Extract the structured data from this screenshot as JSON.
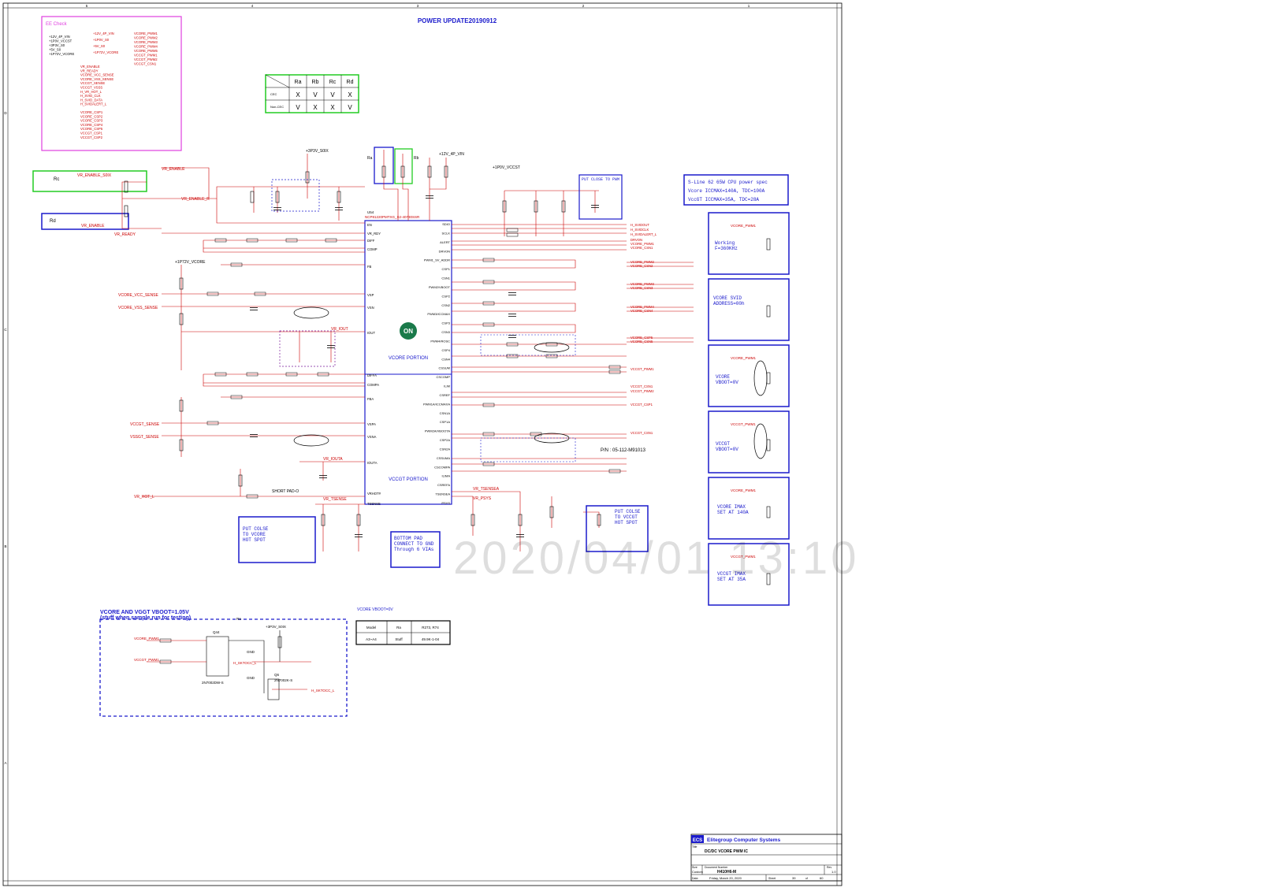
{
  "header": {
    "title": "POWER UPDATE20190912"
  },
  "ee_check": {
    "title": "EE Check",
    "rails": [
      "+12V_4P_VIN",
      "+1P0V_VCCST",
      "+3P3V_S0",
      "+5V_S0",
      "+1P72V_VCORE"
    ],
    "rail_nets": [
      "+12V_4P_VIN",
      "+1P0V_S0",
      "+5V_S0",
      "+1P72V_VCORE"
    ],
    "pwm_nets": [
      "VCORE_PWM1",
      "VCORE_PWM2",
      "VCORE_PWM3",
      "VCORE_PWM4",
      "VCORE_PWM5",
      "VCCGT_PWM1",
      "VCCGT_PWM2",
      "VCCGT_CSN1"
    ],
    "enable_nets": [
      "VR_ENABLE",
      "VR_READY",
      "VCORE_VCC_SENSE",
      "VCORE_VSS_SENSE",
      "VCCGT_SENSE",
      "VCCGT_VSSS",
      "H_VR_HOT_L",
      "H_SVID_CLK",
      "H_SVID_DATA",
      "H_SVIDALERT_L"
    ],
    "csp_nets": [
      "VCORE_CSP1",
      "VCORE_CSP2",
      "VCORE_CSP3",
      "VCORE_CSP4",
      "VCORE_CSP5",
      "VCCGT_CSP1",
      "VCCGT_CSP2"
    ]
  },
  "resistor_table": {
    "headers": [
      "Ra",
      "Rb",
      "Rc",
      "Rd"
    ],
    "rows": [
      {
        "label": "CEC",
        "values": [
          "X",
          "V",
          "V",
          "X"
        ]
      },
      {
        "label": "Non-CEC",
        "values": [
          "V",
          "X",
          "X",
          "V"
        ]
      }
    ]
  },
  "labels": {
    "ra": "Ra",
    "rb": "Rb",
    "rc": "Rc",
    "rd": "Rd",
    "vr_enable_s0ix": "VR_ENABLE_S0IX",
    "vr_enable_r": "VR_ENABLE_R",
    "vr_enable": "VR_ENABLE",
    "vr_ready": "VR_READY",
    "p3v3_s0ix": "+3P3V_S0IX",
    "p5v_s0": "+5V_S0",
    "p12v_4p_vin": "+12V_4P_VIN",
    "p1p0v_vccst": "+1P0V_VCCST",
    "p1p72v_vcore": "+1P72V_VCORE",
    "ic_name": "NCP81220PMTXG_S2-40730SSR",
    "ic_ref": "U54",
    "vcore_portion": "VCORE PORTION",
    "vccgt_portion": "VCCGT PORTION",
    "on_logo": "ON",
    "vcore_vcc_sense": "VCORE_VCC_SENSE",
    "vcore_vss_sense": "VCORE_VSS_SENSE",
    "vccgt_sense": "VCCGT_SENSE",
    "vssgt_sense": "VSSGT_SENSE",
    "vr_hot_l": "VR_HOT_L",
    "vr_tsense": "VR_TSENSE",
    "vr_tsensea": "VR_TSENSEA",
    "vr_psys": "VR_PSYS",
    "vr_iouta": "VR_IOUTA",
    "vr_iout": "VR_IOUT",
    "put_close_pwm": "PUT CLOSE TO PWM",
    "put_close_vcore": "PUT COLSE TO VCORE HOT SPOT",
    "put_close_vccgt": "PUT COLSE TO VCCGT HOT SPOT",
    "bottom_pad": "BOTTOM PAD CONNECT TO GND Through 6 VIAs",
    "spec_1": "S-Line 62 65W CPU power spec",
    "spec_2": "Vcore ICCMAX=140A, TDC=100A",
    "spec_3": "VccGT ICCMAX=35A, TDC=28A",
    "working_freq": "Working F=360KHz",
    "svid_addr": "VCORE SVID ADDRESS=00h",
    "vcore_vboot": "VCORE VBOOT=0V",
    "vccgt_vboot": "VCCGT VBOOT=0V",
    "vcore_imax": "VCORE IMAX SET AT 140A",
    "vccgt_imax": "VCCGT IMAX SET AT 35A",
    "vboot_title_1": "VCORE AND VGGT VBOOT=1.05V",
    "vboot_title_2": "(stuff when sample run for testing)",
    "vcore_vboot_small": "VCORE VBOOT=0V",
    "vcore_pwm1": "VCORE_PWM1",
    "vccgt_pwm1": "VCCGT_PWM1",
    "h_skt_occ_l": "H_SKTOCC_L",
    "pn": "P/N : 05-112-M91013",
    "short_pad": "SHORT PAD-O",
    "gnd": "GND",
    "q44": "Q44",
    "q6": "Q6",
    "q44_part": "2N7002DW-S",
    "q6_part": "2N7002K-S"
  },
  "vboot_table": {
    "rows": [
      [
        "Model",
        "Ra",
        "R273, R74"
      ],
      [
        "A3~A4",
        "Stuff",
        "49.9K-1-04"
      ]
    ]
  },
  "right_nets": [
    "H_SVIDOUT",
    "H_SVIDCLK",
    "H_SVIDALERT_L",
    "DRVON",
    "VCORE_PWM1",
    "VCORE_CSN1",
    "VCORE_PWM2",
    "VCORE_CSN2",
    "VCORE_PWM3",
    "VCORE_CSN3",
    "VCORE_PWM4",
    "VCORE_CSN4",
    "VCORE_CSP5",
    "VCORE_CSN5",
    "VCCGT_PWM1",
    "VCCGT_CSN1",
    "VCCGT_PWM2",
    "VCCGT_CSP1",
    "VCCGT_CSN1"
  ],
  "ic_pins_left": [
    "EN",
    "VR_RDY",
    "DIFF",
    "COMP",
    "FB",
    "VSP",
    "VSN",
    "IOUT",
    "DIFFA",
    "COMPA",
    "FBA",
    "VSPA",
    "VSNA",
    "IOUTA",
    "VRHOT#",
    "TSENSE"
  ],
  "ic_pins_right": [
    "SDIO",
    "SCLK",
    "ALERT",
    "DRVON",
    "PWM1_SV_ADDR",
    "CSP1",
    "CSN1",
    "PWM2/VBOOT",
    "CSP2",
    "CSN2",
    "PWM3/ICCMAX",
    "CSP3",
    "CSN3",
    "PWM4/ROSC",
    "CSP4",
    "CSN4",
    "CSSUM",
    "CSCOMP",
    "ILIM",
    "CSREF",
    "PWM1A/ICCMAXA",
    "CSN1A",
    "CSP1A",
    "PWM2A/VBOOTA",
    "CSP2A",
    "CSN2A",
    "CSSUMA",
    "CSCOMPA",
    "ILIMA",
    "CSREFA",
    "TSENSEA",
    "PSYS"
  ],
  "title_block": {
    "company": "Elitegroup Computer Systems",
    "logo": "ECS",
    "title_label": "Title",
    "title": "DC/DC VCORE PWM IC",
    "size_label": "Size",
    "size": "Custom",
    "doc_label": "Document Number",
    "doc": "H410H6-M",
    "rev_label": "Rev",
    "rev": "1.0",
    "date_label": "Date:",
    "date": "Friday, March 20, 2020",
    "sheet_label": "Sheet",
    "sheet": "39",
    "of_label": "of",
    "sheets": "60"
  },
  "watermark": "2020/04/01 13:10",
  "border": {
    "cols": [
      "5",
      "4",
      "3",
      "2",
      "1"
    ],
    "rows": [
      "D",
      "C",
      "B",
      "A"
    ]
  },
  "colors": {
    "wire": "#cc0000",
    "box": "#1a1acc",
    "ee": "#e040e0",
    "green": "#22cc22",
    "text": "#000000"
  }
}
